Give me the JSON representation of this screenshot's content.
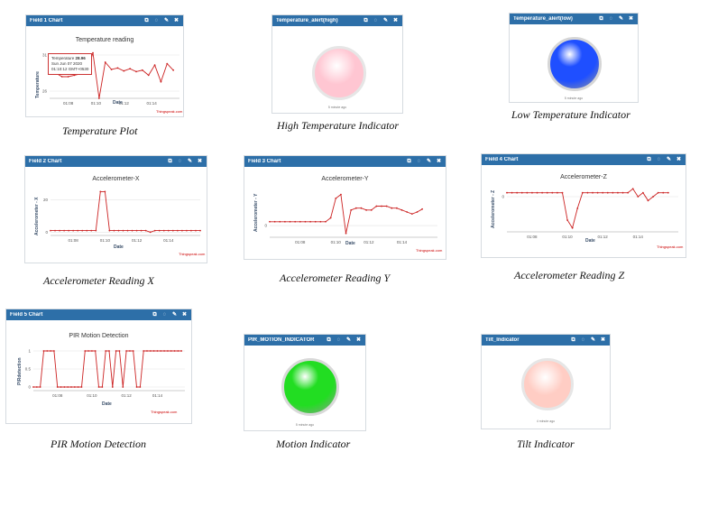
{
  "panels": {
    "field1": {
      "title": "Field 1 Chart",
      "chart_title": "Temperature reading",
      "ylabel": "Temperature",
      "xlabel": "Date",
      "source": "Thingspeak.com",
      "caption": "Temperature Plot",
      "tooltip": {
        "name": "Temperature",
        "value": "28.96",
        "date": "Sun Jun 07 2020",
        "time": "01:10:12 GMT+0530"
      }
    },
    "high": {
      "title": "Temperature_alert(high)",
      "ago": "5 minute ago",
      "caption": "High Temperature Indicator"
    },
    "low": {
      "title": "Temperature_alert(low)",
      "ago": "5 minute ago",
      "caption": "Low Temperature Indicator"
    },
    "field2": {
      "title": "Field 2 Chart",
      "chart_title": "Accelerometer-X",
      "ylabel": "Accelerometer - X",
      "xlabel": "Date",
      "source": "Thingspeak.com",
      "caption": "Accelerometer Reading X"
    },
    "field3": {
      "title": "Field 3 Chart",
      "chart_title": "Accelerometer-Y",
      "ylabel": "Accelerometer - Y",
      "xlabel": "Date",
      "source": "Thingspeak.com",
      "caption": "Accelerometer Reading Y"
    },
    "field4": {
      "title": "Field 4 Chart",
      "chart_title": "Accelerometer-Z",
      "ylabel": "Accelerometer - Z",
      "xlabel": "Date",
      "source": "Thingspeak.com",
      "caption": "Accelerometer Reading Z"
    },
    "field5": {
      "title": "Field 5 Chart",
      "chart_title": "PIR Motion Detection",
      "ylabel": "PIRdetection",
      "xlabel": "Date",
      "source": "Thingspeak.com",
      "caption": "PIR Motion Detection"
    },
    "motion": {
      "title": "PIR_MOTION_INDICATOR",
      "ago": "5 minute ago",
      "caption": "Motion Indicator"
    },
    "tilt": {
      "title": "Tilt_Indicator",
      "ago": "4 minute ago",
      "caption": "Tilt Indicator"
    }
  },
  "indicators": {
    "high": {
      "color": "#ffc6d2",
      "state": "off"
    },
    "low": {
      "color": "#1f4fff",
      "state": "on"
    },
    "motion": {
      "color": "#22dd22",
      "state": "on"
    },
    "tilt": {
      "color": "#ffcdc4",
      "state": "off"
    }
  },
  "header_icons": [
    "external-link-icon",
    "comment-icon",
    "pencil-icon",
    "close-icon"
  ],
  "line_color": "#cc2222",
  "chart_data": [
    {
      "id": "c1",
      "type": "line",
      "title": "Temperature reading",
      "xlabel": "Date",
      "ylabel": "Temperature",
      "ylim": [
        25,
        31.5
      ],
      "yticks": [
        "26",
        "31"
      ],
      "ytick_values": [
        26,
        31
      ],
      "xticks": [
        "01:08",
        "01:10",
        "01:12",
        "01:14"
      ],
      "xtick_values": [
        3,
        7.5,
        12,
        16.5
      ],
      "xlim": [
        0,
        21
      ],
      "x": [
        0,
        1,
        2,
        3,
        4,
        5,
        6,
        7,
        8,
        9,
        10,
        11,
        12,
        13,
        14,
        15,
        16,
        17,
        18,
        19,
        20
      ],
      "values": [
        29,
        28.5,
        28,
        28,
        28.2,
        28.4,
        28.5,
        31.3,
        25,
        30,
        29,
        29.2,
        28.8,
        29.1,
        28.7,
        28.9,
        28.2,
        29.6,
        27.3,
        29.8,
        28.9
      ]
    },
    {
      "id": "c2",
      "type": "line",
      "title": "Accelerometer-X",
      "xlabel": "Date",
      "ylabel": "Accelerometer - X",
      "ylim": [
        -2,
        28
      ],
      "yticks": [
        "0",
        "20"
      ],
      "ytick_values": [
        0,
        20
      ],
      "xticks": [
        "01:08",
        "01:10",
        "01:12",
        "01:14"
      ],
      "xtick_values": [
        5,
        12,
        19,
        26
      ],
      "xlim": [
        0,
        33
      ],
      "x": [
        0,
        1,
        2,
        3,
        4,
        5,
        6,
        7,
        8,
        9,
        10,
        11,
        12,
        13,
        14,
        15,
        16,
        17,
        18,
        19,
        20,
        21,
        22,
        23,
        24,
        25,
        26,
        27,
        28,
        29,
        30,
        31,
        32,
        33
      ],
      "values": [
        1,
        1,
        1,
        1,
        1,
        1,
        1,
        1,
        1,
        1,
        1,
        25,
        25,
        1,
        1,
        1,
        1,
        1,
        1,
        1,
        1,
        1,
        0,
        1,
        1,
        1,
        1,
        1,
        1,
        1,
        1,
        1,
        1,
        1
      ]
    },
    {
      "id": "c3",
      "type": "line",
      "title": "Accelerometer-Y",
      "xlabel": "Date",
      "ylabel": "Accelerometer - Y",
      "ylim": [
        -6,
        20
      ],
      "yticks": [
        "0"
      ],
      "ytick_values": [
        0
      ],
      "xticks": [
        "01:08",
        "01:10",
        "01:12",
        "01:14"
      ],
      "xtick_values": [
        6,
        13,
        19.5,
        26
      ],
      "xlim": [
        0,
        33
      ],
      "x": [
        0,
        1,
        2,
        3,
        4,
        5,
        6,
        7,
        8,
        9,
        10,
        11,
        12,
        13,
        14,
        15,
        16,
        17,
        18,
        19,
        20,
        21,
        22,
        23,
        24,
        25,
        26,
        27,
        28,
        29,
        30
      ],
      "values": [
        2,
        2,
        2,
        2,
        2,
        2,
        2,
        2,
        2,
        2,
        2,
        2,
        4,
        14,
        16,
        -4,
        8,
        9,
        9,
        8,
        8,
        10,
        10,
        10,
        9,
        9,
        8,
        7,
        6,
        7,
        8.5
      ]
    },
    {
      "id": "c4",
      "type": "line",
      "title": "Accelerometer-Z",
      "xlabel": "Date",
      "ylabel": "Accelerometer - Z",
      "ylim": [
        -9,
        3
      ],
      "yticks": [
        "0"
      ],
      "ytick_values": [
        0
      ],
      "xticks": [
        "01:08",
        "01:10",
        "01:12",
        "01:14"
      ],
      "xtick_values": [
        5,
        12,
        19,
        26
      ],
      "xlim": [
        0,
        34
      ],
      "x": [
        0,
        1,
        2,
        3,
        4,
        5,
        6,
        7,
        8,
        9,
        10,
        11,
        12,
        13,
        14,
        15,
        16,
        17,
        18,
        19,
        20,
        21,
        22,
        23,
        24,
        25,
        26,
        27,
        28,
        29,
        30,
        31,
        32
      ],
      "values": [
        1,
        1,
        1,
        1,
        1,
        1,
        1,
        1,
        1,
        1,
        1,
        1,
        -6,
        -8,
        -3,
        1,
        1,
        1,
        1,
        1,
        1,
        1,
        1,
        1,
        1,
        2,
        0,
        1,
        -1,
        0,
        1,
        1,
        1
      ]
    },
    {
      "id": "c5",
      "type": "line",
      "title": "PIR Motion Detection",
      "xlabel": "Date",
      "ylabel": "PIRdetection",
      "ylim": [
        -0.1,
        1.1
      ],
      "yticks": [
        "0",
        "0.5",
        "1"
      ],
      "ytick_values": [
        0,
        0.5,
        1
      ],
      "xticks": [
        "01:08",
        "01:10",
        "01:12",
        "01:14"
      ],
      "xtick_values": [
        7,
        17,
        27,
        36
      ],
      "xlim": [
        0,
        44
      ],
      "x": [
        0,
        1,
        2,
        3,
        4,
        5,
        6,
        7,
        8,
        9,
        10,
        11,
        12,
        13,
        14,
        15,
        16,
        17,
        18,
        19,
        20,
        21,
        22,
        23,
        24,
        25,
        26,
        27,
        28,
        29,
        30,
        31,
        32,
        33,
        34,
        35,
        36,
        37,
        38,
        39,
        40,
        41,
        42,
        43
      ],
      "values": [
        0,
        0,
        0,
        1,
        1,
        1,
        1,
        0,
        0,
        0,
        0,
        0,
        0,
        0,
        0,
        1,
        1,
        1,
        1,
        0,
        0,
        1,
        1,
        0,
        1,
        1,
        0,
        1,
        1,
        1,
        0,
        0,
        1,
        1,
        1,
        1,
        1,
        1,
        1,
        1,
        1,
        1,
        1,
        1
      ]
    }
  ]
}
